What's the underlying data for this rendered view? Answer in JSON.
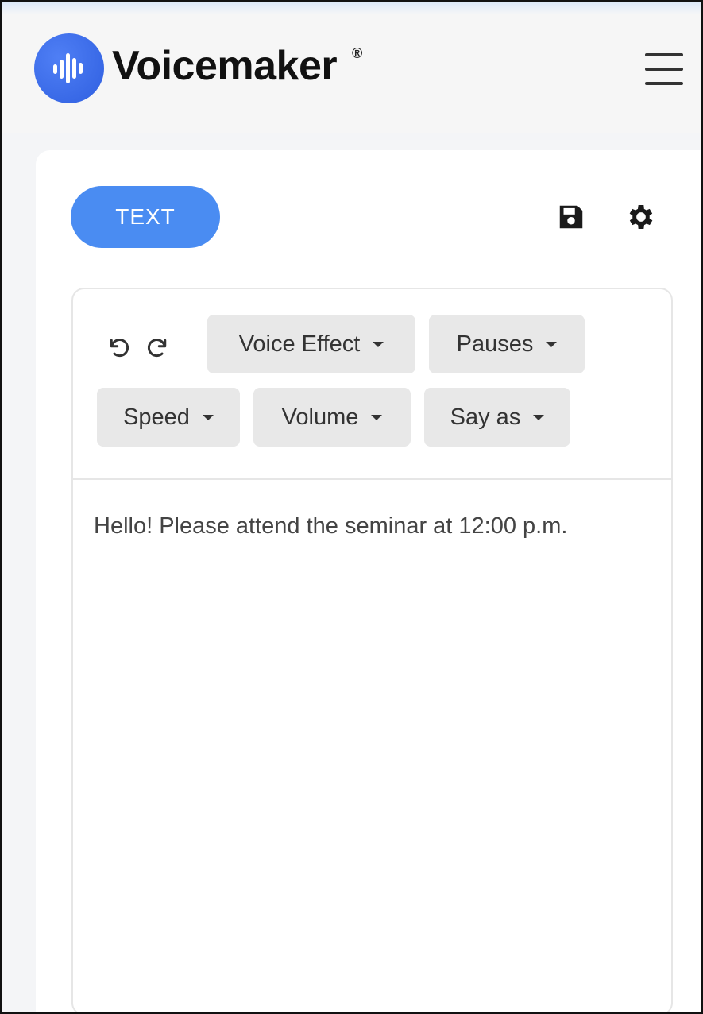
{
  "header": {
    "brand_name": "Voicemaker",
    "brand_mark": "®",
    "logo_icon": "sound-wave-logo-icon",
    "menu_icon": "hamburger-menu-icon"
  },
  "card": {
    "active_tab_label": "TEXT",
    "save_icon": "floppy-disk-icon",
    "settings_icon": "gear-icon"
  },
  "toolbar": {
    "undo_icon": "undo-icon",
    "redo_icon": "redo-icon",
    "voice_effect_label": "Voice Effect",
    "pauses_label": "Pauses",
    "speed_label": "Speed",
    "volume_label": "Volume",
    "say_as_label": "Say as"
  },
  "editor": {
    "content": "Hello! Please attend the seminar at 12:00 p.m."
  },
  "colors": {
    "accent": "#4a8cf2",
    "logo": "#3a6ae8",
    "toolbar_button": "#e8e8e8",
    "text": "#444444"
  }
}
